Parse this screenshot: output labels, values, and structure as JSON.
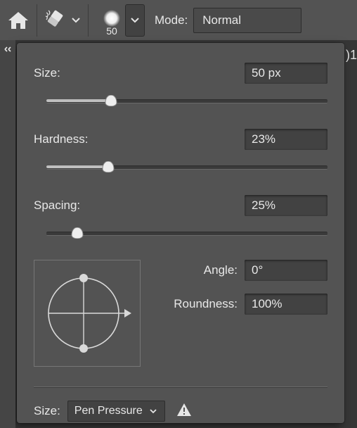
{
  "toolbar": {
    "brush_size_label": "50",
    "mode_label": "Mode:",
    "mode_value": "Normal"
  },
  "panel": {
    "size": {
      "label": "Size:",
      "value": "50 px",
      "pct": 23
    },
    "hardness": {
      "label": "Hardness:",
      "value": "23%",
      "pct": 22
    },
    "spacing": {
      "label": "Spacing:",
      "value": "25%",
      "pct": 11
    },
    "angle": {
      "label": "Angle:",
      "value": "0°"
    },
    "roundness": {
      "label": "Roundness:",
      "value": "100%"
    },
    "dynamics_label": "Size:",
    "dynamics_value": "Pen Pressure"
  },
  "right_text": ")1"
}
